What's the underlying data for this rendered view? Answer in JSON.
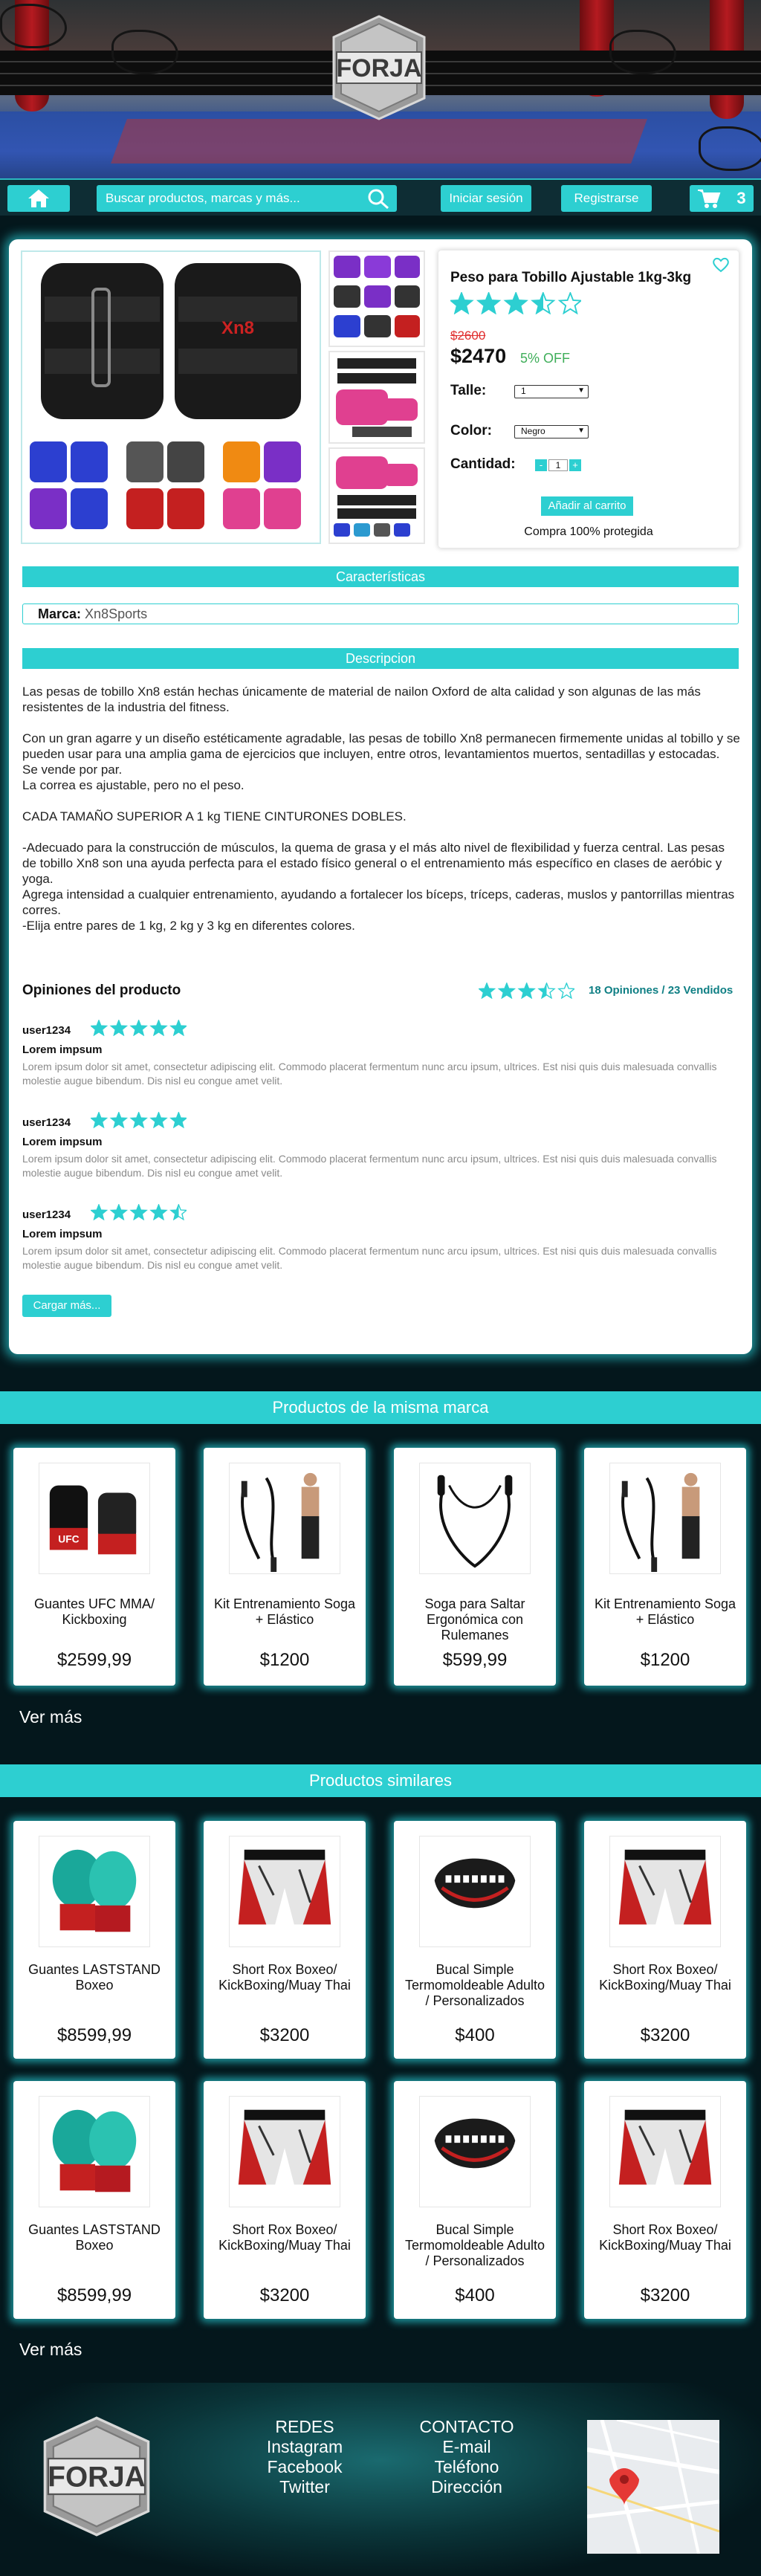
{
  "brand": {
    "logo_text": "FORJA"
  },
  "nav": {
    "search_placeholder": "Buscar productos, marcas y más...",
    "login_label": "Iniciar sesión",
    "register_label": "Registrarse",
    "cart_count": "3"
  },
  "product": {
    "title": "Peso para Tobillo Ajustable 1kg-3kg",
    "rating": 3.5,
    "old_price": "$2600",
    "price": "$2470",
    "discount": "5% OFF",
    "size_label": "Talle:",
    "size_value": "1",
    "color_label": "Color:",
    "color_value": "Negro",
    "qty_label": "Cantidad:",
    "qty_value": "1",
    "qty_minus": "-",
    "qty_plus": "+",
    "add_cart_label": "Añadir al carrito",
    "protected_label": "Compra 100% protegida",
    "image_brand": "Xn8"
  },
  "features": {
    "heading": "Características",
    "brand_label": "Marca:",
    "brand_value": "Xn8Sports"
  },
  "description": {
    "heading": "Descripcion",
    "p1": "Las pesas de tobillo Xn8 están hechas únicamente de material de nailon Oxford de alta calidad y son algunas de las más resistentes de la industria del fitness.",
    "p2": "Con un gran agarre y un diseño estéticamente agradable, las pesas de tobillo Xn8 permanecen firmemente unidas al tobillo y se pueden usar para una amplia gama de ejercicios que incluyen, entre otros, levantamientos muertos, sentadillas y estocadas.",
    "p3": "Se vende por par.",
    "p4": "La correa es ajustable, pero no el peso.",
    "p5": "CADA TAMAÑO SUPERIOR A 1 kg TIENE CINTURONES DOBLES.",
    "p6": "-Adecuado para la construcción de músculos, la quema de grasa y el más alto nivel de flexibilidad y fuerza central. Las pesas de tobillo Xn8 son una ayuda perfecta para el estado físico general o el entrenamiento más específico en clases de aeróbic y yoga.",
    "p7": "Agrega intensidad a cualquier entrenamiento, ayudando a fortalecer los bíceps, tríceps, caderas, muslos y pantorrillas mientras corres.",
    "p8": "-Elija entre pares de 1 kg, 2 kg y 3 kg en diferentes colores."
  },
  "reviews": {
    "heading": "Opiniones del producto",
    "summary_rating": 3.5,
    "summary": "18 Opiniones / 23 Vendidos",
    "items": [
      {
        "user": "user1234",
        "rating": 5,
        "title": "Lorem impsum",
        "body": "Lorem ipsum dolor sit amet, consectetur adipiscing elit. Commodo placerat fermentum nunc arcu ipsum, ultrices. Est nisi quis duis malesuada convallis molestie augue bibendum. Dis nisl eu congue amet velit."
      },
      {
        "user": "user1234",
        "rating": 5,
        "title": "Lorem impsum",
        "body": "Lorem ipsum dolor sit amet, consectetur adipiscing elit. Commodo placerat fermentum nunc arcu ipsum, ultrices. Est nisi quis duis malesuada convallis molestie augue bibendum. Dis nisl eu congue amet velit."
      },
      {
        "user": "user1234",
        "rating": 4.5,
        "title": "Lorem impsum",
        "body": "Lorem ipsum dolor sit amet, consectetur adipiscing elit. Commodo placerat fermentum nunc arcu ipsum, ultrices. Est nisi quis duis malesuada convallis molestie augue bibendum. Dis nisl eu congue amet velit."
      }
    ],
    "load_more": "Cargar más..."
  },
  "same_brand": {
    "heading": "Productos de la misma marca",
    "items": [
      {
        "name": "Guantes UFC MMA/ Kickboxing",
        "price": "$2599,99",
        "icon": "mma-gloves"
      },
      {
        "name": "Kit Entrenamiento Soga + Elástico",
        "price": "$1200",
        "icon": "training-kit"
      },
      {
        "name": "Soga para Saltar Ergonómica con Rulemanes",
        "price": "$599,99",
        "icon": "jump-rope"
      },
      {
        "name": "Kit Entrenamiento Soga + Elástico",
        "price": "$1200",
        "icon": "training-kit"
      }
    ],
    "more": "Ver más"
  },
  "similar": {
    "heading": "Productos similares",
    "items": [
      {
        "name": "Guantes LASTSTAND Boxeo",
        "price": "$8599,99",
        "icon": "boxing-gloves"
      },
      {
        "name": "Short Rox Boxeo/ KickBoxing/Muay Thai",
        "price": "$3200",
        "icon": "shorts"
      },
      {
        "name": "Bucal Simple Termomoldeable Adulto / Personalizados",
        "price": "$400",
        "icon": "mouthguard"
      },
      {
        "name": "Short Rox Boxeo/ KickBoxing/Muay Thai",
        "price": "$3200",
        "icon": "shorts"
      },
      {
        "name": "Guantes LASTSTAND Boxeo",
        "price": "$8599,99",
        "icon": "boxing-gloves"
      },
      {
        "name": "Short Rox Boxeo/ KickBoxing/Muay Thai",
        "price": "$3200",
        "icon": "shorts"
      },
      {
        "name": "Bucal Simple Termomoldeable Adulto / Personalizados",
        "price": "$400",
        "icon": "mouthguard"
      },
      {
        "name": "Short Rox Boxeo/ KickBoxing/Muay Thai",
        "price": "$3200",
        "icon": "shorts"
      }
    ],
    "more": "Ver más"
  },
  "footer": {
    "social_heading": "REDES",
    "social": [
      "Instagram",
      "Facebook",
      "Twitter"
    ],
    "contact_heading": "CONTACTO",
    "contact": [
      "E-mail",
      "Teléfono",
      "Dirección"
    ]
  },
  "colors": {
    "accent": "#2dcfd1",
    "star": "#2dcfd1",
    "discount": "#3fae5a",
    "background": "#04171c"
  }
}
